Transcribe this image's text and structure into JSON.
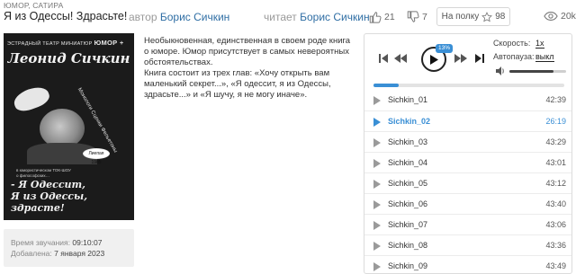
{
  "genre": "ЮМОР, САТИРА",
  "title": "Я из Одессы! Здрасьте!",
  "author": {
    "label": "автор",
    "name": "Борис Сичкин"
  },
  "reader": {
    "label": "читает",
    "name": "Борис Сичкин"
  },
  "stats": {
    "likes": "21",
    "dislikes": "7",
    "shelf_label": "На полку",
    "shelf_count": "98",
    "views": "20k"
  },
  "cover": {
    "top_line": "ЭСТРАДНЫЙ ТЕАТР МИНИАТЮР",
    "top_bold": "ЮМОР +",
    "name": "Леонид Сичкин",
    "side_text": "Монологи  Сценки  Фельетоны",
    "badge": "Лиепая 1985",
    "mid_text": "в юмористическом ТОК-ШОУ\nо философских…",
    "slogan": "- Я Одессит,\nЯ из Одессы,\nздрасте!"
  },
  "description": {
    "p1": "Необыкновенная, единственная в своем роде книга о юморе. Юмор присутствует в самых невероятных обстоятельствах.",
    "p2": "Книга состоит из трех глав: «Хочу открыть вам маленький секрет...», «Я одессит, я из Одессы, здрасьте...» и «Я шучу, я не могу иначе»."
  },
  "meta": {
    "duration_label": "Время звучания:",
    "duration": "09:10:07",
    "added_label": "Добавлена:",
    "added": "7 января 2023"
  },
  "player": {
    "progress_badge": "13%",
    "progress": 0.13,
    "speed_label": "Скорость:",
    "speed_value": "1x",
    "autopause_label": "Автопауза:",
    "autopause_value": "выкл",
    "volume": 0.78,
    "tracks": [
      {
        "name": "Sichkin_01",
        "duration": "42:39",
        "active": false
      },
      {
        "name": "Sichkin_02",
        "duration": "26:19",
        "active": true
      },
      {
        "name": "Sichkin_03",
        "duration": "43:29",
        "active": false
      },
      {
        "name": "Sichkin_04",
        "duration": "43:01",
        "active": false
      },
      {
        "name": "Sichkin_05",
        "duration": "43:12",
        "active": false
      },
      {
        "name": "Sichkin_06",
        "duration": "43:40",
        "active": false
      },
      {
        "name": "Sichkin_07",
        "duration": "43:06",
        "active": false
      },
      {
        "name": "Sichkin_08",
        "duration": "43:36",
        "active": false
      },
      {
        "name": "Sichkin_09",
        "duration": "43:49",
        "active": false
      }
    ]
  },
  "colors": {
    "accent": "#3a8fd5",
    "link": "#2f6ea4"
  }
}
